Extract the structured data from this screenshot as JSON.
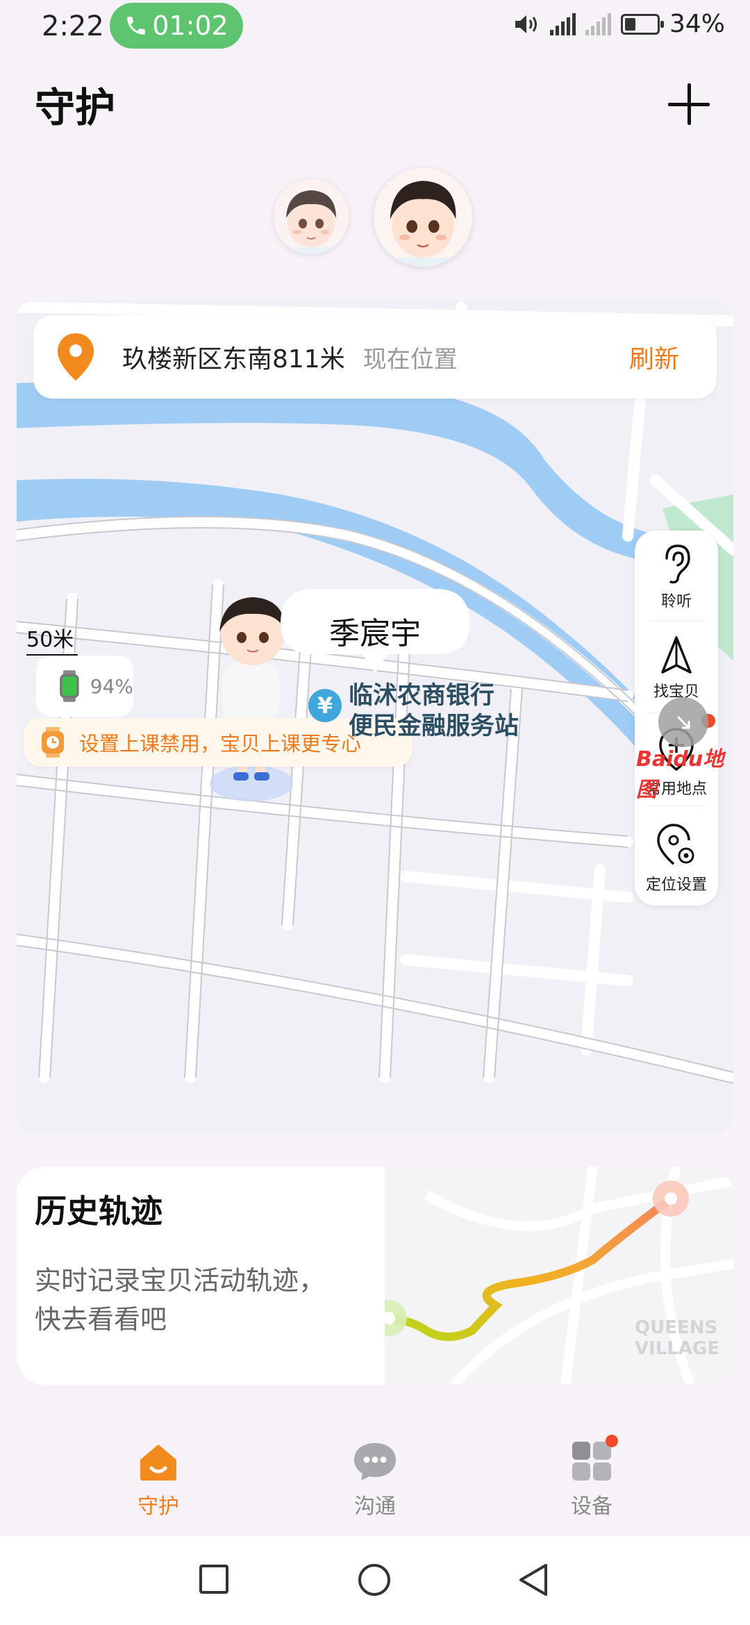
{
  "status_bar": {
    "time": "2:22",
    "call_timer": "01:02",
    "battery": "34%"
  },
  "header": {
    "title": "守护"
  },
  "map": {
    "location_address": "玖楼新区东南811米",
    "location_status": "现在位置",
    "refresh": "刷新",
    "child_name": "季宸宇",
    "scale": "50米",
    "watch_battery": "94%",
    "class_banner": "设置上课禁用，宝贝上课更专心",
    "poi_line1": "临沭农商银行",
    "poi_line2": "便民金融服务站",
    "poi_icon": "¥",
    "baidu": "Baidu地图",
    "side_items": [
      "聆听",
      "找宝贝",
      "常用地点",
      "定位设置"
    ]
  },
  "history": {
    "title": "历史轨迹",
    "desc": "实时记录宝贝活动轨迹，快去看看吧",
    "map_label": "QUEENS VILLAGE"
  },
  "bottom_nav": {
    "home": "守护",
    "chat": "沟通",
    "device": "设备"
  },
  "colors": {
    "accent": "#ef7a1c",
    "call_green": "#5fc46f",
    "river": "#9fccf5"
  }
}
